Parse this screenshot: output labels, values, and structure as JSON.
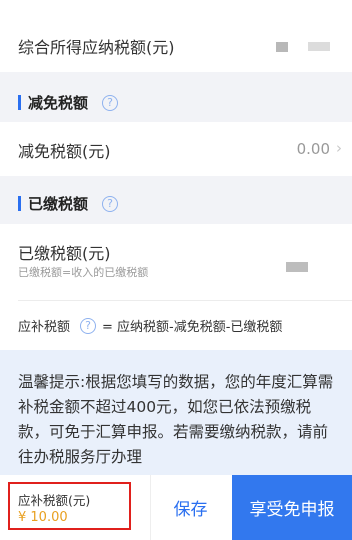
{
  "comprehensive": {
    "label": "综合所得应纳税额(元)"
  },
  "deduction": {
    "section_title": "减免税额",
    "row_label": "减免税额(元)",
    "value": "0.00"
  },
  "paid": {
    "section_title": "已缴税额",
    "row_label": "已缴税额(元)",
    "hint": "已缴税额=收入的已缴税额"
  },
  "formula": {
    "label": "应补税额",
    "text": "= 应纳税额-减免税额-已缴税额"
  },
  "tip": {
    "text": "温馨提示:根据您填写的数据，您的年度汇算需补税金额不超过400元，如您已依法预缴税款，可免于汇算申报。若需要缴纳税款，请前往办税服务厅办理"
  },
  "footer": {
    "due_label": "应补税额(元)",
    "due_amount": "¥ 10.00",
    "save_label": "保存",
    "exempt_label": "享受免申报"
  },
  "colors": {
    "accent": "#2a6ff0",
    "button": "#3278ee",
    "amount": "#e8a020",
    "highlight": "#e0201c"
  }
}
